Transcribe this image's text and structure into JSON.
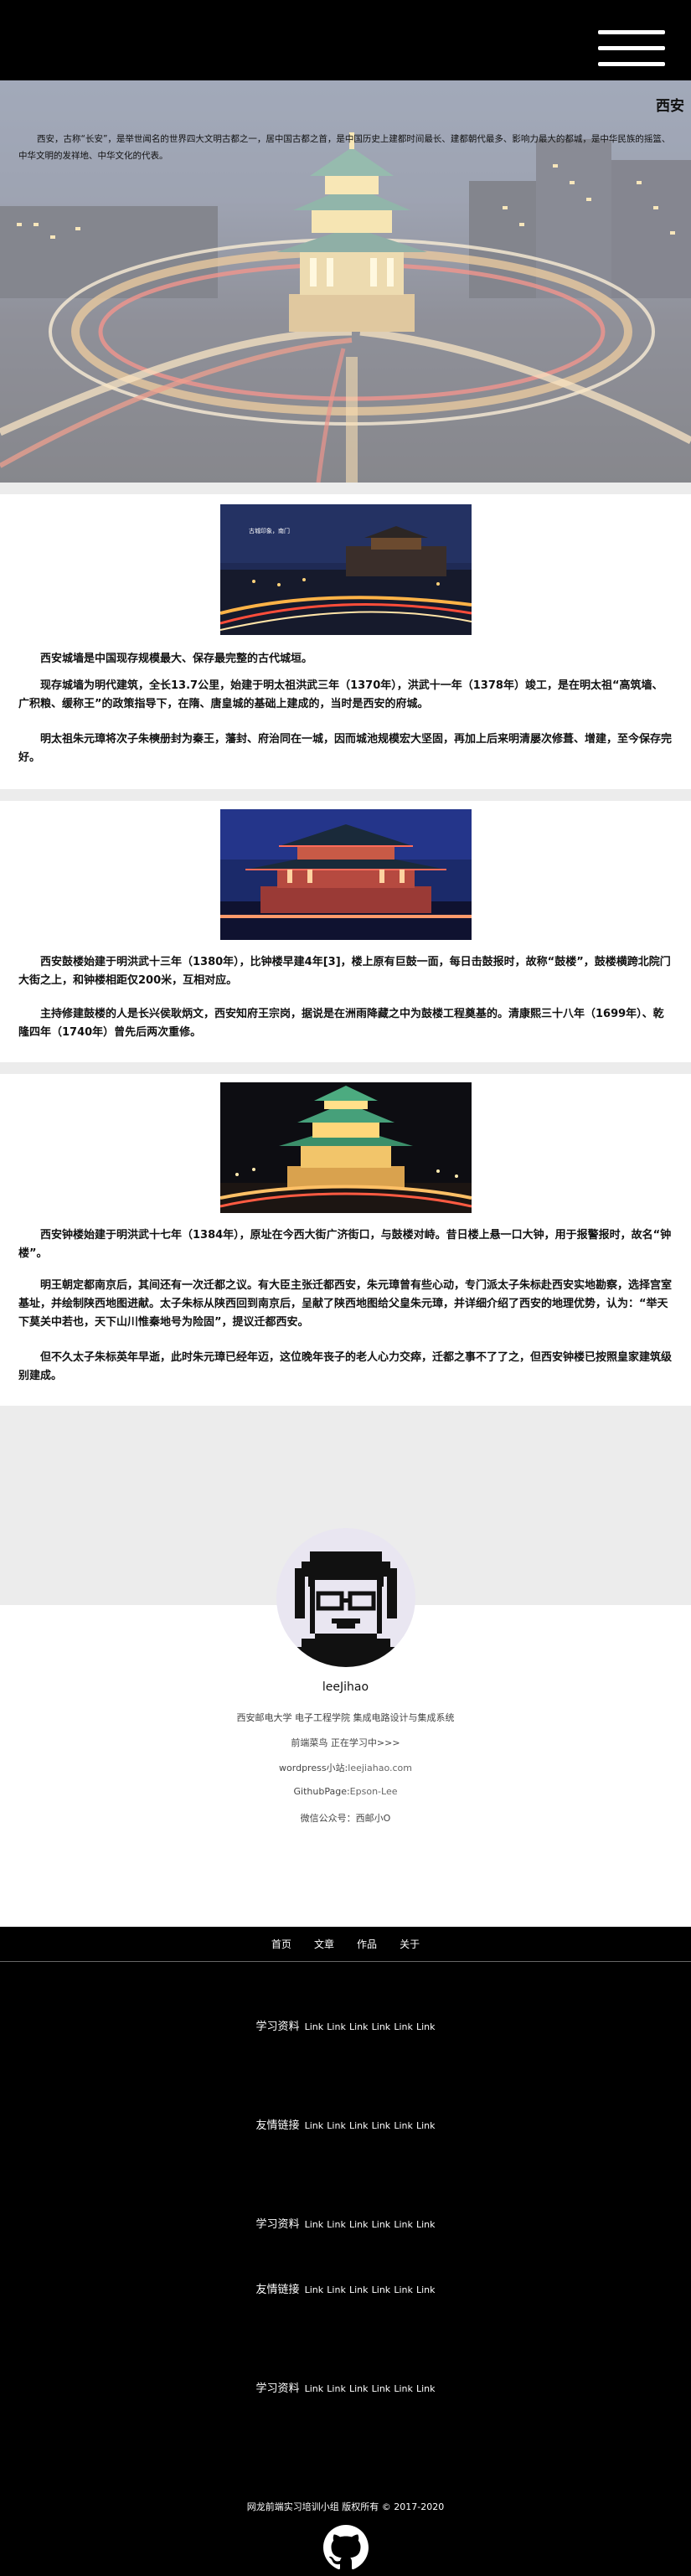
{
  "header": {
    "menu_icon": "hamburger-menu-icon"
  },
  "hero": {
    "title": "西安",
    "intro": "西安，古称“长安”，是举世闻名的世界四大文明古都之一，居中国古都之首，是中国历史上建都时间最长、建都朝代最多、影响力最大的都城，是中华民族的摇篮、中华文明的发祥地、中华文化的代表。"
  },
  "sections": [
    {
      "photo_caption": "古城印象，南门",
      "paragraphs": [
        "西安城墙是中国现存规模最大、保存最完整的古代城垣。",
        "现存城墙为明代建筑，全长13.7公里，始建于明太祖洪武三年（1370年），洪武十一年（1378年）竣工，是在明太祖“高筑墙、广积粮、缓称王”的政策指导下，在隋、唐皇城的基础上建成的，当时是西安的府城。",
        "明太祖朱元璋将次子朱樉册封为秦王，藩封、府治同在一城，因而城池规模宏大坚固，再加上后来明清屡次修葺、增建，至今保存完好。"
      ]
    },
    {
      "paragraphs": [
        "西安鼓楼始建于明洪武十三年（1380年），比钟楼早建4年[3]，楼上原有巨鼓一面，每日击鼓报时，故称“鼓楼”，鼓楼横跨北院门大街之上，和钟楼相距仅200米，互相对应。",
        "主持修建鼓楼的人是长兴侯耿炳文，西安知府王宗岗，据说是在洲雨降藏之中为鼓楼工程奠基的。清康熙三十八年（1699年）、乾隆四年（1740年）曾先后两次重修。"
      ]
    },
    {
      "paragraphs": [
        "西安钟楼始建于明洪武十七年（1384年），原址在今西大街广济街口，与鼓楼对峙。昔日楼上悬一口大钟，用于报警报时，故名“钟楼”。",
        "明王朝定都南京后，其间还有一次迁都之议。有大臣主张迁都西安，朱元璋曾有些心动，专门派太子朱标赴西安实地勘察，选择宫室基址，并绘制陕西地图进献。太子朱标从陕西回到南京后，呈献了陕西地图给父皇朱元璋，并详细介绍了西安的地理优势，认为：“举天下莫关中若也，天下山川惟秦地号为险固”，提议迁都西安。",
        "但不久太子朱标英年早逝，此时朱元璋已经年迈，这位晚年丧子的老人心力交瘁，迁都之事不了了之，但西安钟楼已按照皇家建筑级别建成。"
      ]
    }
  ],
  "profile": {
    "name": "leeJihao",
    "school": "西安邮电大学 电子工程学院 集成电路设计与集成系统",
    "role": "前端菜鸟 正在学习中>>>",
    "wordpress_label": "wordpress小站:",
    "wordpress_link": "leejiahao.com",
    "github_label": "GithubPage:",
    "github_link": "Epson-Lee",
    "wechat": "微信公众号：西邮小O"
  },
  "footer": {
    "nav": [
      "首页",
      "文章",
      "作品",
      "关于"
    ],
    "rows": [
      {
        "label": "学习资料",
        "links": [
          "Link",
          "Link",
          "Link",
          "Link",
          "Link",
          "Link"
        ]
      },
      {
        "label": "友情链接",
        "links": [
          "Link",
          "Link",
          "Link",
          "Link",
          "Link",
          "Link"
        ]
      },
      {
        "label": "学习资料",
        "links": [
          "Link",
          "Link",
          "Link",
          "Link",
          "Link",
          "Link"
        ]
      },
      {
        "label": "友情链接",
        "links": [
          "Link",
          "Link",
          "Link",
          "Link",
          "Link",
          "Link"
        ]
      },
      {
        "label": "学习资料",
        "links": [
          "Link",
          "Link",
          "Link",
          "Link",
          "Link",
          "Link"
        ]
      }
    ],
    "copyright": "网龙前端实习培训小组 版权所有 © 2017-2020",
    "social_icon": "github-octocat-icon"
  }
}
